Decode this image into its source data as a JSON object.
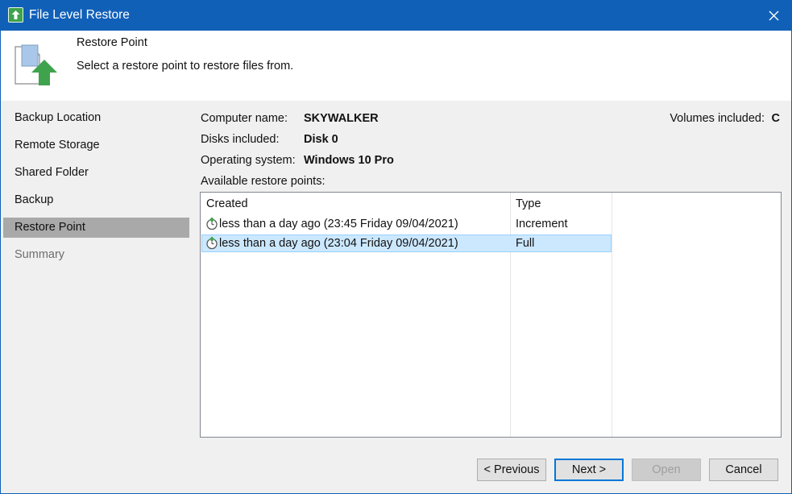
{
  "window": {
    "title": "File Level Restore",
    "icon": "app-restore-icon",
    "close_icon": "close-icon"
  },
  "header": {
    "title": "Restore Point",
    "description": "Select a restore point to restore files from.",
    "icon": "restore-document-icon"
  },
  "sidebar": {
    "items": [
      {
        "label": "Backup Location",
        "state": "normal"
      },
      {
        "label": "Remote Storage",
        "state": "normal"
      },
      {
        "label": "Shared Folder",
        "state": "normal"
      },
      {
        "label": "Backup",
        "state": "normal"
      },
      {
        "label": "Restore Point",
        "state": "active"
      },
      {
        "label": "Summary",
        "state": "disabled"
      }
    ]
  },
  "info": {
    "computer_name_label": "Computer name:",
    "computer_name_value": "SKYWALKER",
    "disks_label": "Disks included:",
    "disks_value": "Disk 0",
    "os_label": "Operating system:",
    "os_value": "Windows 10 Pro",
    "volumes_label": "Volumes included:",
    "volumes_value": "C"
  },
  "restore_points": {
    "label": "Available restore points:",
    "columns": [
      "Created",
      "Type"
    ],
    "rows": [
      {
        "created": "less than a day ago (23:45 Friday 09/04/2021)",
        "type": "Increment",
        "selected": false,
        "icon": "restore-point-clock-icon"
      },
      {
        "created": "less than a day ago (23:04 Friday 09/04/2021)",
        "type": "Full",
        "selected": true,
        "icon": "restore-point-clock-icon"
      }
    ]
  },
  "buttons": {
    "previous": "< Previous",
    "next": "Next >",
    "open": "Open",
    "cancel": "Cancel"
  },
  "colors": {
    "titlebar": "#1160b8",
    "selection": "#cce8ff",
    "active_nav": "#a9a9a9",
    "accent_green": "#3fa34d"
  }
}
